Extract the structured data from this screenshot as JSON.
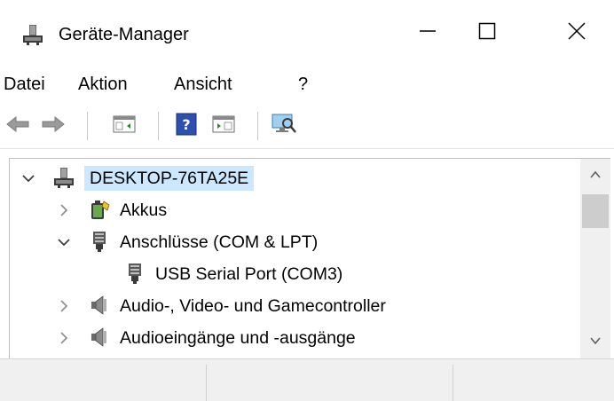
{
  "window": {
    "title": "Geräte-Manager",
    "minimize_glyph": "—",
    "maximize_glyph": "☐",
    "close_glyph": "✕"
  },
  "menu": {
    "items": [
      "Datei",
      "Aktion",
      "Ansicht",
      "?"
    ]
  },
  "toolbar": {
    "buttons": [
      "back-arrow-icon",
      "forward-arrow-icon",
      "show-hide-console-tree-icon",
      "help-icon",
      "action-pane-icon",
      "scan-hardware-icon"
    ]
  },
  "tree": {
    "root": {
      "label": "DESKTOP-76TA25E",
      "icon": "computer-icon",
      "expanded": true,
      "selected": true
    },
    "items": [
      {
        "label": "Akkus",
        "icon": "battery-icon",
        "expanded": false
      },
      {
        "label": "Anschlüsse (COM & LPT)",
        "icon": "port-icon",
        "expanded": true
      },
      {
        "label": "USB Serial Port (COM3)",
        "icon": "port-icon",
        "child": true
      },
      {
        "label": "Audio-, Video- und Gamecontroller",
        "icon": "speaker-icon",
        "expanded": false
      },
      {
        "label": "Audioeingänge und -ausgänge",
        "icon": "speaker-icon",
        "expanded": false
      }
    ]
  },
  "scrollbar": {
    "up_glyph": "^",
    "down_glyph": "v"
  },
  "colors": {
    "selection": "#cce8ff",
    "statusbar": "#f0f0f0",
    "chevron": "#808080"
  }
}
